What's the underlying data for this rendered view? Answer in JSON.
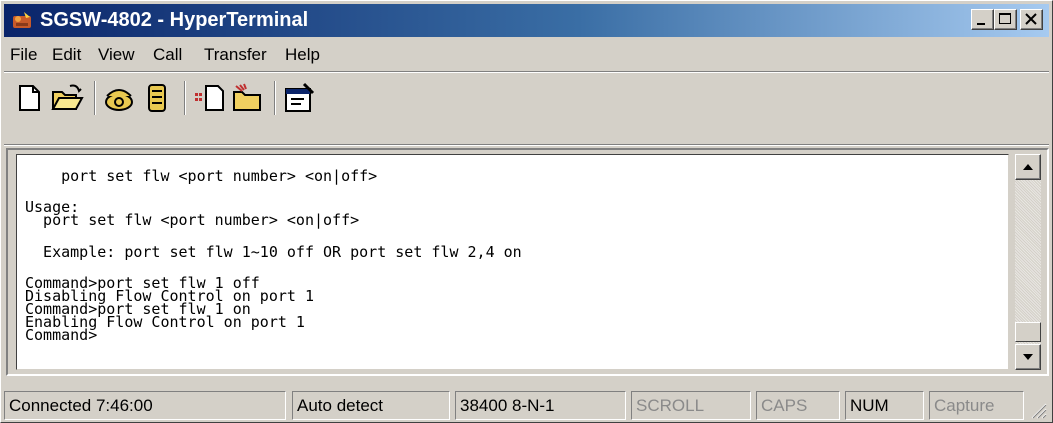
{
  "window": {
    "title": "SGSW-4802 - HyperTerminal",
    "controls": [
      "minimize",
      "maximize",
      "close"
    ]
  },
  "menu": {
    "items": [
      "File",
      "Edit",
      "View",
      "Call",
      "Transfer",
      "Help"
    ]
  },
  "toolbar": {
    "icons": [
      "new-document-icon",
      "open-folder-icon",
      "call-phone-icon",
      "disconnect-phone-icon",
      "send-file-icon",
      "receive-file-icon",
      "properties-icon"
    ]
  },
  "terminal": {
    "lines": [
      "    port set flw <port number> <on|off>",
      "Usage:",
      "  port set flw <port number> <on|off>",
      "  Example: port set flw 1~10 off OR port set flw 2,4 on",
      "Command>port set flw 1 off",
      "Disabling Flow Control on port 1",
      "Command>port set flw 1 on",
      "Enabling Flow Control on port 1",
      "Command>"
    ]
  },
  "statusbar": {
    "connected": "Connected 7:46:00",
    "detect": "Auto detect",
    "settings": "38400 8-N-1",
    "scroll": "SCROLL",
    "caps": "CAPS",
    "num": "NUM",
    "capture": "Capture"
  },
  "colors": {
    "title_gradient_start": "#0a246a",
    "title_gradient_end": "#a6caf0",
    "chrome": "#d4d0c8",
    "terminal_bg": "#ffffff"
  }
}
